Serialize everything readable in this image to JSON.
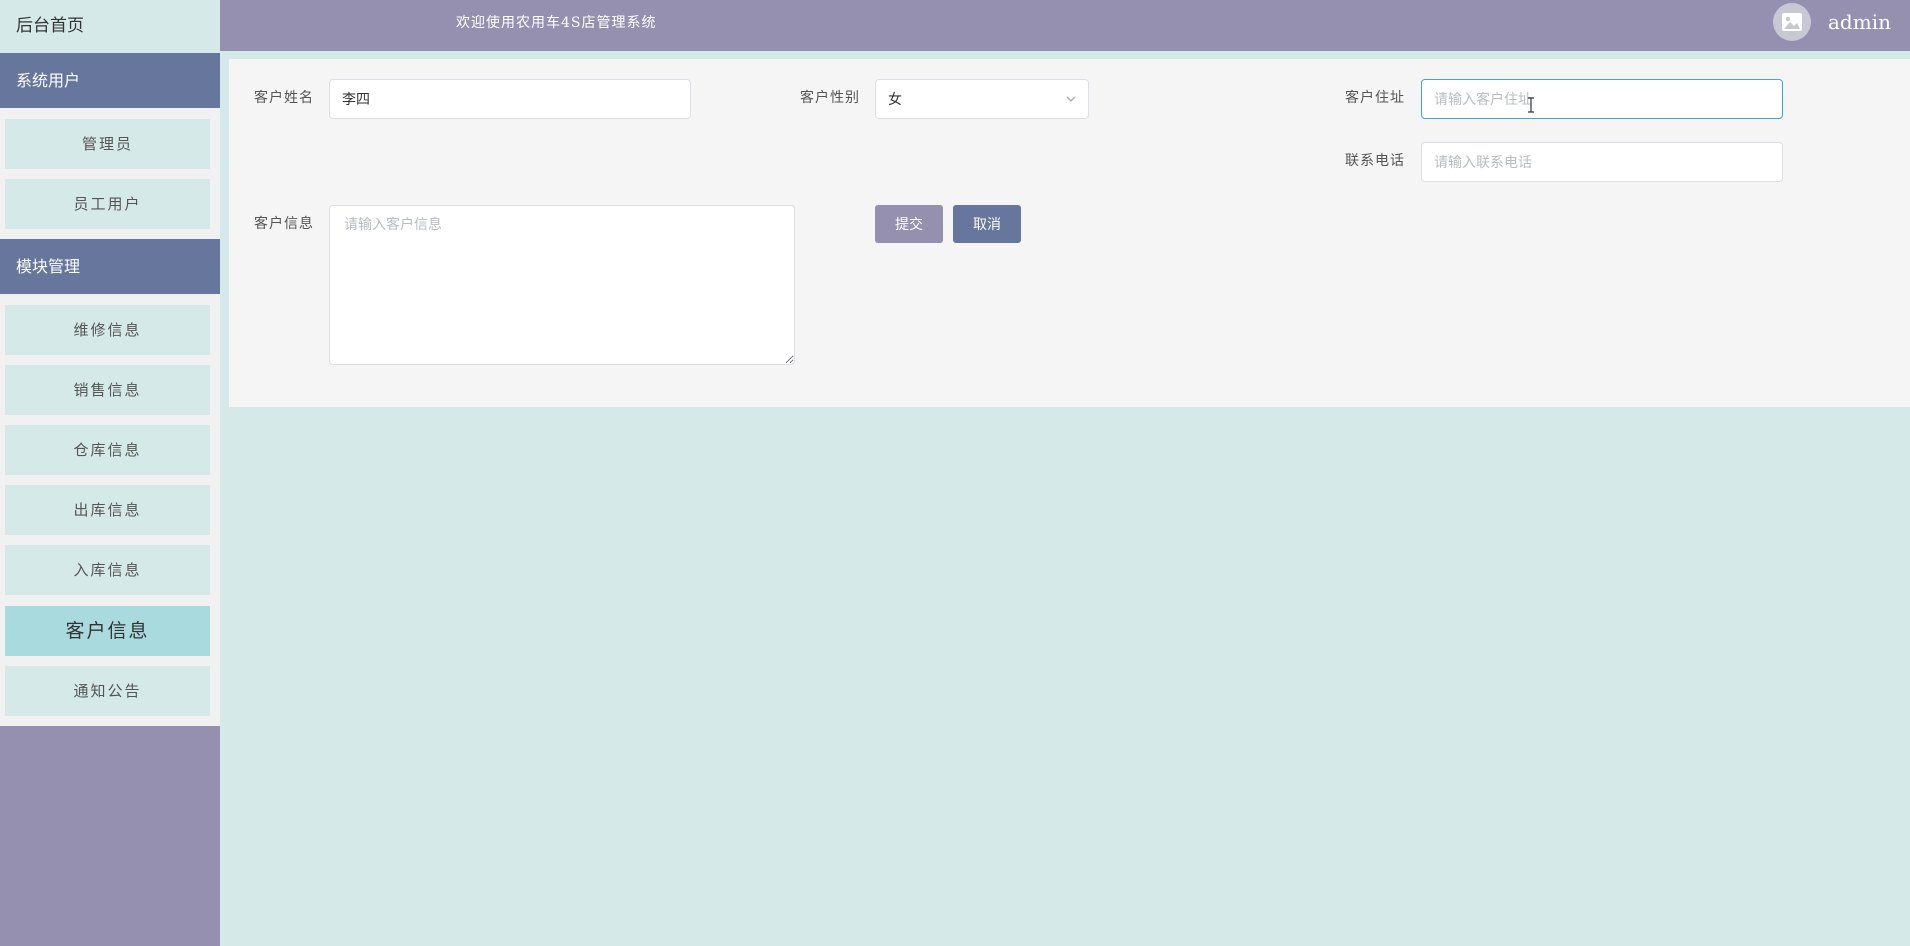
{
  "sidebar": {
    "home_label": "后台首页",
    "groups": [
      {
        "title": "系统用户",
        "items": [
          "管理员",
          "员工用户"
        ]
      },
      {
        "title": "模块管理",
        "items": [
          "维修信息",
          "销售信息",
          "仓库信息",
          "出库信息",
          "入库信息",
          "客户信息",
          "通知公告"
        ]
      }
    ],
    "active_item": "客户信息"
  },
  "header": {
    "welcome_text": "欢迎使用农用车4S店管理系统",
    "username": "admin",
    "avatar_icon": "image-icon"
  },
  "form": {
    "name": {
      "label": "客户姓名",
      "value": "李四"
    },
    "gender": {
      "label": "客户性别",
      "value": "女"
    },
    "address": {
      "label": "客户住址",
      "placeholder": "请输入客户住址"
    },
    "phone": {
      "label": "联系电话",
      "placeholder": "请输入联系电话"
    },
    "info": {
      "label": "客户信息",
      "placeholder": "请输入客户信息"
    },
    "submit_label": "提交",
    "cancel_label": "取消"
  },
  "colors": {
    "accent": "#9690b0",
    "header_blue": "#66769c",
    "background": "#d5e9e8",
    "active_item": "#a9dadd",
    "focus_border": "#409eff"
  }
}
